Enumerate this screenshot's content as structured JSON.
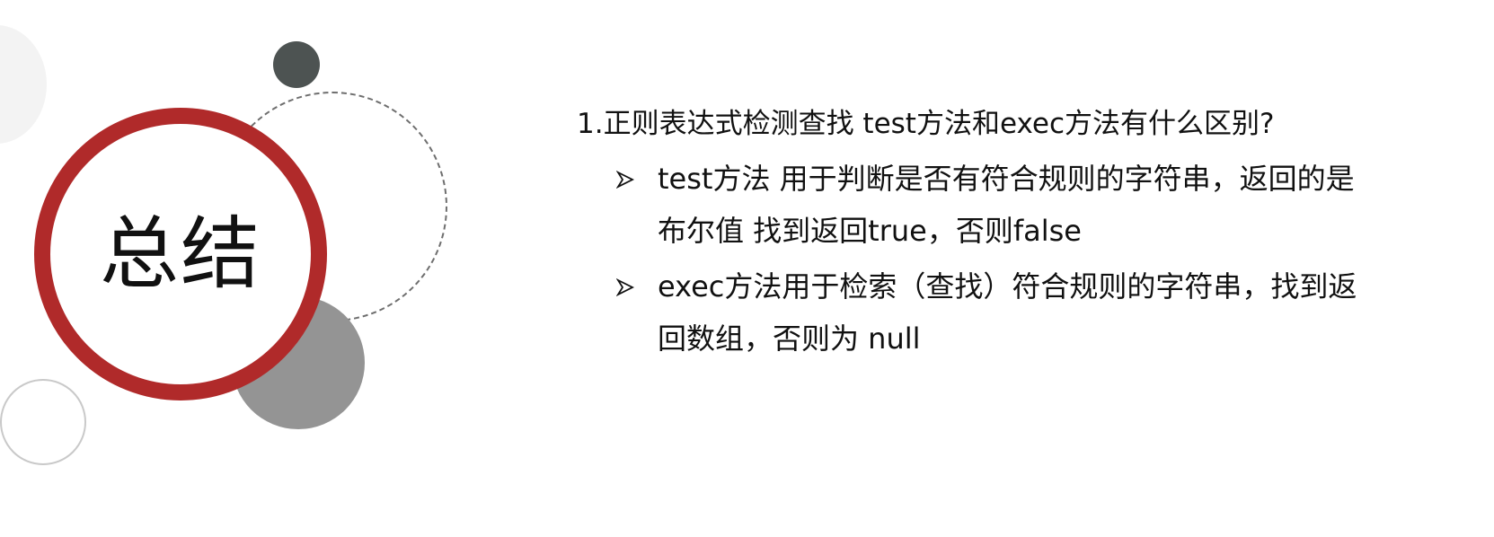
{
  "title": "总结",
  "question": "1.正则表达式检测查找  test方法和exec方法有什么区别?",
  "bullets": [
    {
      "text": "test方法 用于判断是否有符合规则的字符串，返回的是布尔值 找到返回true，否则false",
      "icon": "arrow-bullet-icon"
    },
    {
      "text": "exec方法用于检索（查找）符合规则的字符串，找到返回数组，否则为 null",
      "icon": "arrow-bullet-icon"
    }
  ],
  "colors": {
    "accent_red": "#b02a2a",
    "dark_gray": "#4d5352",
    "mid_gray": "#949494",
    "light_gray": "#f3f3f3",
    "dashed_gray": "#6e6e6e",
    "text": "#111111"
  }
}
